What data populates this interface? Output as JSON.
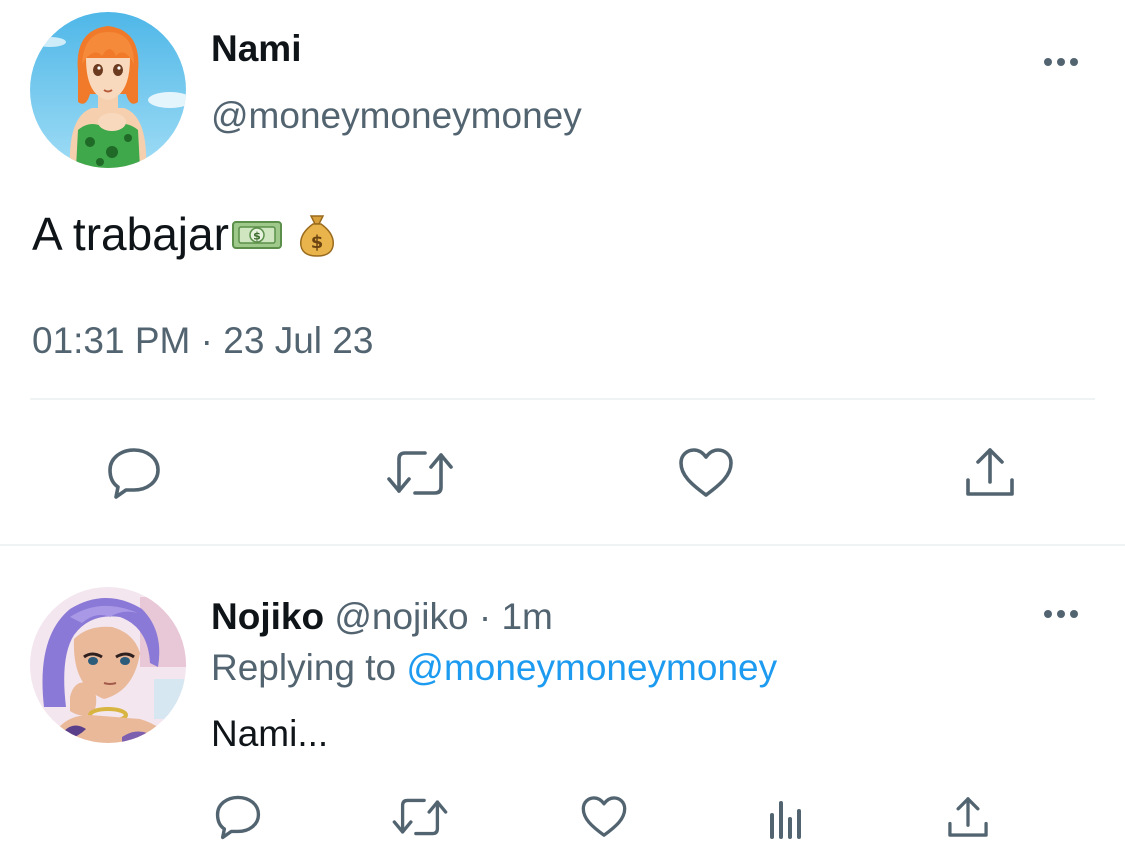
{
  "main_tweet": {
    "author": {
      "name": "Nami",
      "handle": "@moneymoneymoney",
      "avatar_icon": "nami-avatar"
    },
    "text": "A trabajar",
    "emojis": [
      "money-bill-emoji",
      "money-bag-emoji"
    ],
    "time": "01:31 PM",
    "separator": "·",
    "date": "23 Jul 23",
    "actions": [
      "reply-icon",
      "retweet-icon",
      "like-icon",
      "share-icon"
    ]
  },
  "reply": {
    "author": {
      "name": "Nojiko",
      "handle": "@nojiko",
      "avatar_icon": "nojiko-avatar"
    },
    "separator": "·",
    "age": "1m",
    "replying_label": "Replying to",
    "replying_handle": "@moneymoneymoney",
    "text": "Nami...",
    "actions": [
      "reply-icon",
      "retweet-icon",
      "like-icon",
      "analytics-icon",
      "share-icon"
    ]
  },
  "colors": {
    "text_primary": "#0f1419",
    "text_secondary": "#536471",
    "link": "#1d9bf0",
    "divider": "#eff3f4"
  }
}
